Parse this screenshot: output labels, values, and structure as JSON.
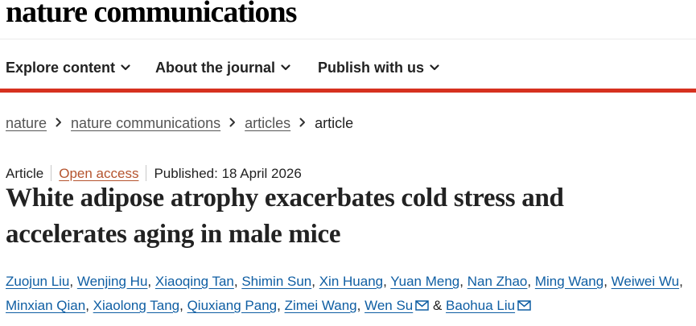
{
  "site": {
    "brand": "nature communications"
  },
  "nav": {
    "items": [
      {
        "label": "Explore content"
      },
      {
        "label": "About the journal"
      },
      {
        "label": "Publish with us"
      }
    ]
  },
  "breadcrumb": {
    "items": [
      "nature",
      "nature communications",
      "articles"
    ],
    "current": "article"
  },
  "article": {
    "type": "Article",
    "access": "Open access",
    "published": "Published: 18 April 2026",
    "title": "White adipose atrophy exacerbates cold stress and accelerates aging in male mice",
    "authors": [
      "Zuojun Liu",
      "Wenjing Hu",
      "Xiaoqing Tan",
      "Shimin Sun",
      "Xin Huang",
      "Yuan Meng",
      "Nan Zhao",
      "Ming Wang",
      "Weiwei Wu",
      "Minxian Qian",
      "Xiaolong Tang",
      "Qiuxiang Pang",
      "Zimei Wang",
      "Wen Su",
      "Baohua Liu"
    ],
    "author_separator": ",",
    "author_and": "&"
  },
  "colors": {
    "accent_red": "#d6311f",
    "author_link": "#0f5ea3",
    "open_access": "#b5542e"
  },
  "icons": {
    "nav_chevron": "chevron-down-icon",
    "breadcrumb_separator": "chevron-right-icon",
    "author_contact": "mail-icon"
  }
}
